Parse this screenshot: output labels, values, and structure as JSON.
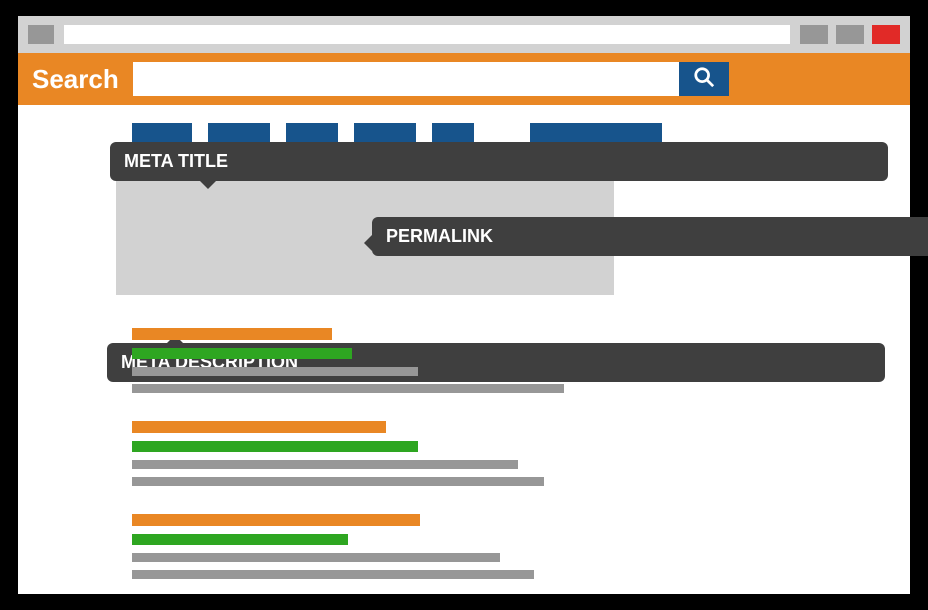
{
  "searchbar": {
    "label": "Search",
    "value": "",
    "placeholder": ""
  },
  "callouts": {
    "meta_title": "META TITLE",
    "permalink": "PERMALINK",
    "meta_description": "META DESCRIPTION"
  }
}
